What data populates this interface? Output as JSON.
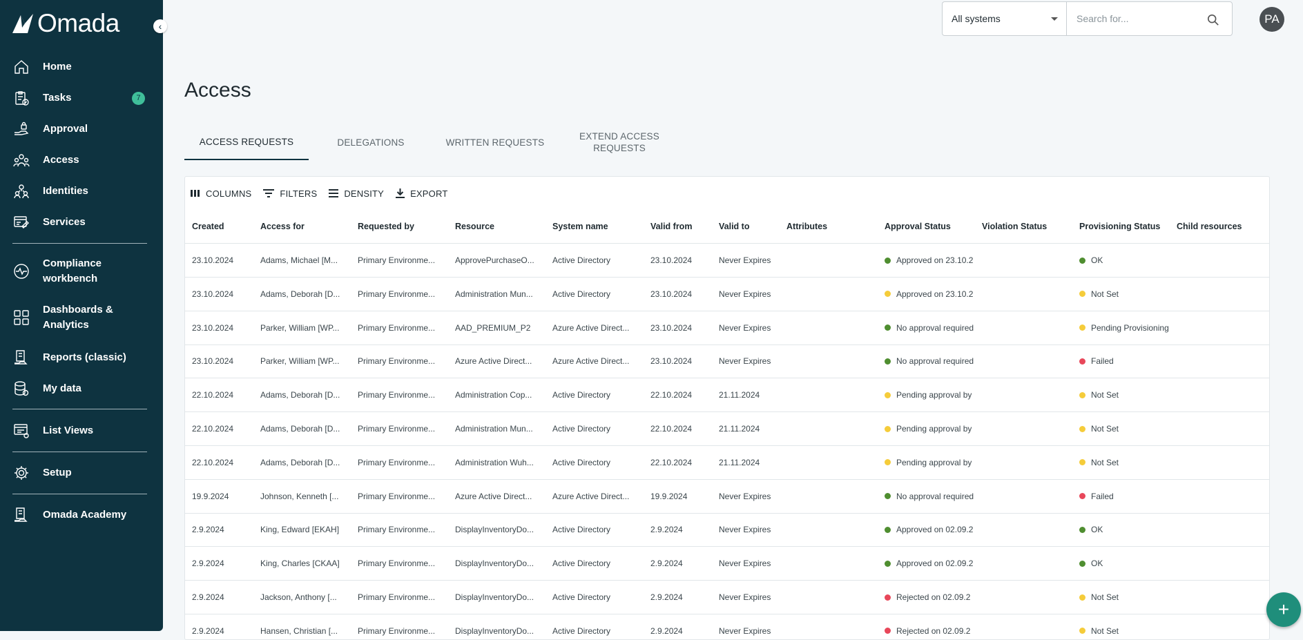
{
  "brand": {
    "logo_text": "Omada"
  },
  "sidebar": {
    "items": [
      {
        "label": "Home",
        "icon": "home-icon"
      },
      {
        "label": "Tasks",
        "icon": "clipboard-icon",
        "badge": "7"
      },
      {
        "label": "Approval",
        "icon": "approval-icon"
      },
      {
        "label": "Access",
        "icon": "people-icon"
      },
      {
        "label": "Identities",
        "icon": "identities-icon"
      },
      {
        "label": "Services",
        "icon": "services-icon"
      },
      {
        "label": "Compliance workbench",
        "icon": "pulse-icon"
      },
      {
        "label": "Dashboards & Analytics",
        "icon": "dashboard-icon"
      },
      {
        "label": "Reports (classic)",
        "icon": "reports-icon"
      },
      {
        "label": "My data",
        "icon": "database-icon"
      },
      {
        "label": "List Views",
        "icon": "list-views-icon"
      },
      {
        "label": "Setup",
        "icon": "gear-icon"
      },
      {
        "label": "Omada Academy",
        "icon": "academy-icon"
      }
    ]
  },
  "topbar": {
    "system_select": "All systems",
    "search_placeholder": "Search for...",
    "avatar_initials": "PA"
  },
  "page": {
    "title": "Access"
  },
  "tabs": [
    {
      "label": "ACCESS REQUESTS",
      "active": true
    },
    {
      "label": "DELEGATIONS",
      "active": false
    },
    {
      "label": "WRITTEN REQUESTS",
      "active": false
    },
    {
      "label": "EXTEND ACCESS REQUESTS",
      "active": false
    }
  ],
  "toolbar": {
    "columns": "COLUMNS",
    "filters": "FILTERS",
    "density": "DENSITY",
    "export": "EXPORT"
  },
  "table": {
    "columns": [
      "Created",
      "Access for",
      "Requested by",
      "Resource",
      "System name",
      "Valid from",
      "Valid to",
      "Attributes",
      "Approval Status",
      "Violation Status",
      "Provisioning Status",
      "Child resources"
    ],
    "rows": [
      {
        "created": "23.10.2024",
        "access_for": "Adams, Michael [M...",
        "requested_by": "Primary Environme...",
        "resource": "ApprovePurchaseO...",
        "system": "Active Directory",
        "valid_from": "23.10.2024",
        "valid_to": "Never Expires",
        "attributes": "",
        "approval": "Approved on 23.10.2",
        "approval_color": "green",
        "violation": "",
        "provisioning": "OK",
        "prov_color": "green",
        "child": ""
      },
      {
        "created": "23.10.2024",
        "access_for": "Adams, Deborah [D...",
        "requested_by": "Primary Environme...",
        "resource": "Administration Mun...",
        "system": "Active Directory",
        "valid_from": "23.10.2024",
        "valid_to": "Never Expires",
        "attributes": "",
        "approval": "Approved on 23.10.2",
        "approval_color": "yellow",
        "violation": "",
        "provisioning": "Not Set",
        "prov_color": "yellow",
        "child": ""
      },
      {
        "created": "23.10.2024",
        "access_for": "Parker, William [WP...",
        "requested_by": "Primary Environme...",
        "resource": "AAD_PREMIUM_P2",
        "system": "Azure Active Direct...",
        "valid_from": "23.10.2024",
        "valid_to": "Never Expires",
        "attributes": "",
        "approval": "No approval required",
        "approval_color": "green",
        "violation": "",
        "provisioning": "Pending Provisioning",
        "prov_color": "yellow",
        "child": ""
      },
      {
        "created": "23.10.2024",
        "access_for": "Parker, William [WP...",
        "requested_by": "Primary Environme...",
        "resource": "Azure Active Direct...",
        "system": "Azure Active Direct...",
        "valid_from": "23.10.2024",
        "valid_to": "Never Expires",
        "attributes": "",
        "approval": "No approval required",
        "approval_color": "green",
        "violation": "",
        "provisioning": "Failed",
        "prov_color": "red",
        "child": ""
      },
      {
        "created": "22.10.2024",
        "access_for": "Adams, Deborah [D...",
        "requested_by": "Primary Environme...",
        "resource": "Administration Cop...",
        "system": "Active Directory",
        "valid_from": "22.10.2024",
        "valid_to": "21.11.2024",
        "attributes": "",
        "approval": "Pending approval by",
        "approval_color": "yellow",
        "violation": "",
        "provisioning": "Not Set",
        "prov_color": "yellow",
        "child": ""
      },
      {
        "created": "22.10.2024",
        "access_for": "Adams, Deborah [D...",
        "requested_by": "Primary Environme...",
        "resource": "Administration Mun...",
        "system": "Active Directory",
        "valid_from": "22.10.2024",
        "valid_to": "21.11.2024",
        "attributes": "",
        "approval": "Pending approval by",
        "approval_color": "yellow",
        "violation": "",
        "provisioning": "Not Set",
        "prov_color": "yellow",
        "child": ""
      },
      {
        "created": "22.10.2024",
        "access_for": "Adams, Deborah [D...",
        "requested_by": "Primary Environme...",
        "resource": "Administration Wuh...",
        "system": "Active Directory",
        "valid_from": "22.10.2024",
        "valid_to": "21.11.2024",
        "attributes": "",
        "approval": "Pending approval by",
        "approval_color": "yellow",
        "violation": "",
        "provisioning": "Not Set",
        "prov_color": "yellow",
        "child": ""
      },
      {
        "created": "19.9.2024",
        "access_for": "Johnson, Kenneth [...",
        "requested_by": "Primary Environme...",
        "resource": "Azure Active Direct...",
        "system": "Azure Active Direct...",
        "valid_from": "19.9.2024",
        "valid_to": "Never Expires",
        "attributes": "",
        "approval": "No approval required",
        "approval_color": "green",
        "violation": "",
        "provisioning": "Failed",
        "prov_color": "red",
        "child": ""
      },
      {
        "created": "2.9.2024",
        "access_for": "King, Edward [EKAH]",
        "requested_by": "Primary Environme...",
        "resource": "DisplayInventoryDo...",
        "system": "Active Directory",
        "valid_from": "2.9.2024",
        "valid_to": "Never Expires",
        "attributes": "",
        "approval": "Approved on 02.09.2",
        "approval_color": "green",
        "violation": "",
        "provisioning": "OK",
        "prov_color": "green",
        "child": ""
      },
      {
        "created": "2.9.2024",
        "access_for": "King, Charles [CKAA]",
        "requested_by": "Primary Environme...",
        "resource": "DisplayInventoryDo...",
        "system": "Active Directory",
        "valid_from": "2.9.2024",
        "valid_to": "Never Expires",
        "attributes": "",
        "approval": "Approved on 02.09.2",
        "approval_color": "green",
        "violation": "",
        "provisioning": "OK",
        "prov_color": "green",
        "child": ""
      },
      {
        "created": "2.9.2024",
        "access_for": "Jackson, Anthony [...",
        "requested_by": "Primary Environme...",
        "resource": "DisplayInventoryDo...",
        "system": "Active Directory",
        "valid_from": "2.9.2024",
        "valid_to": "Never Expires",
        "attributes": "",
        "approval": "Rejected on 02.09.2",
        "approval_color": "red",
        "violation": "",
        "provisioning": "Not Set",
        "prov_color": "yellow",
        "child": ""
      },
      {
        "created": "2.9.2024",
        "access_for": "Hansen, Christian [...",
        "requested_by": "Primary Environme...",
        "resource": "DisplayInventoryDo...",
        "system": "Active Directory",
        "valid_from": "2.9.2024",
        "valid_to": "Never Expires",
        "attributes": "",
        "approval": "Rejected on 02.09.2",
        "approval_color": "red",
        "violation": "",
        "provisioning": "Not Set",
        "prov_color": "yellow",
        "child": ""
      }
    ]
  },
  "fab": {
    "label": "+"
  },
  "colors": {
    "sidebar_bg": "#0e3340",
    "badge": "#3fbf9a",
    "fab": "#1f8e7b",
    "ok": "#4f8e30",
    "pending": "#f5cc3a",
    "failed": "#e8475a"
  }
}
